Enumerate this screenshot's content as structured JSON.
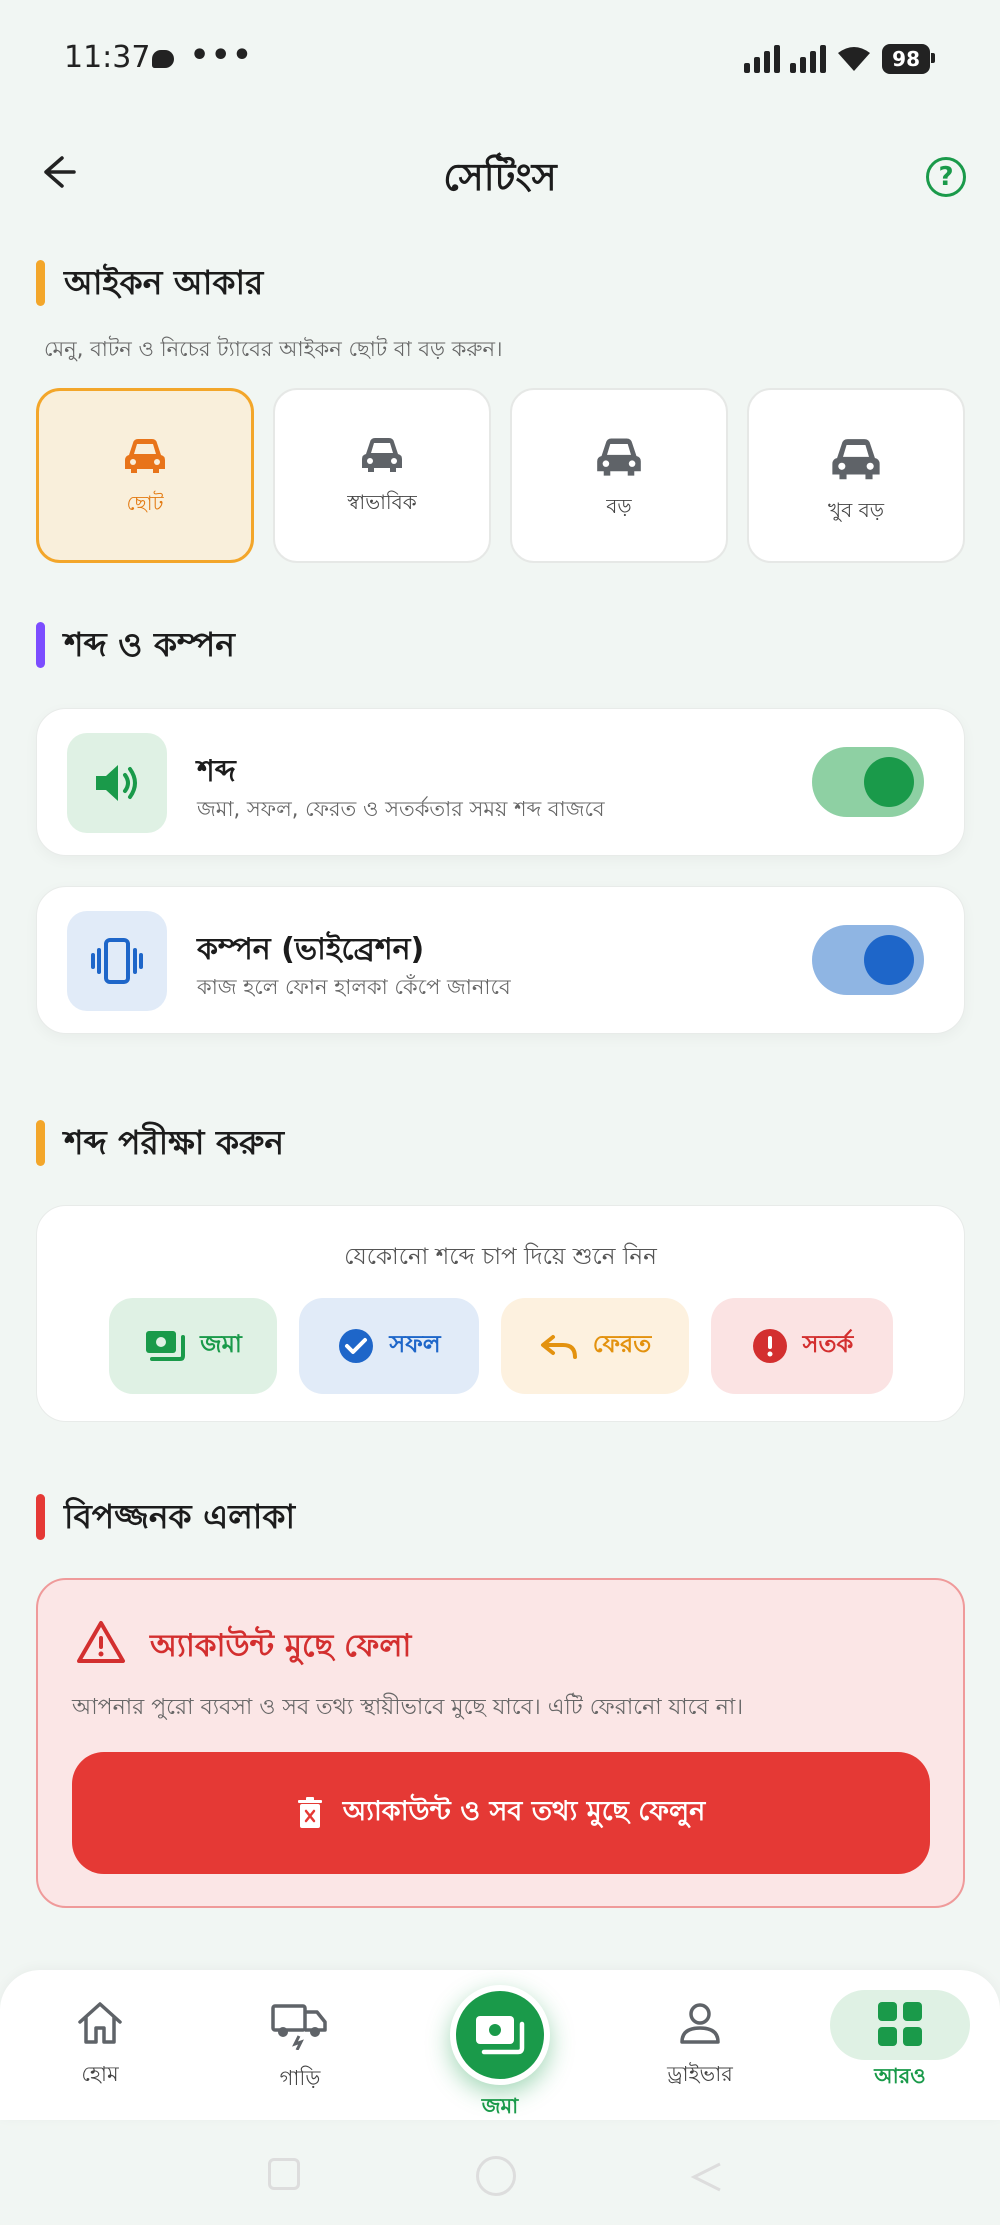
{
  "status": {
    "time": "11:37",
    "dots": "•••",
    "battery": "98"
  },
  "header": {
    "title": "সেটিংস",
    "help": "?"
  },
  "icon_size": {
    "title": "আইকন আকার",
    "desc": "মেনু, বাটন ও নিচের ট্যাবের আইকন ছোট বা বড় করুন।",
    "options": [
      {
        "label": "ছোট",
        "selected": true
      },
      {
        "label": "স্বাভাবিক",
        "selected": false
      },
      {
        "label": "বড়",
        "selected": false
      },
      {
        "label": "খুব বড়",
        "selected": false
      }
    ]
  },
  "sound_vibration": {
    "title": "শব্দ ও কম্পন",
    "sound": {
      "title": "শব্দ",
      "sub": "জমা, সফল, ফেরত ও সতর্কতার সময় শব্দ বাজবে",
      "on": true
    },
    "vibration": {
      "title": "কম্পন (ভাইব্রেশন)",
      "sub": "কাজ হলে ফোন হালকা কেঁপে জানাবে",
      "on": true
    }
  },
  "sound_test": {
    "title": "শব্দ পরীক্ষা করুন",
    "hint": "যেকোনো শব্দে চাপ দিয়ে শুনে নিন",
    "chips": [
      "জমা",
      "সফল",
      "ফেরত",
      "সতর্ক"
    ]
  },
  "danger": {
    "title": "বিপজ্জনক এলাকা",
    "card_title": "অ্যাকাউন্ট মুছে ফেলা",
    "desc": "আপনার পুরো ব্যবসা ও সব তথ্য স্থায়ীভাবে মুছে যাবে। এটি ফেরানো যাবে না।",
    "button": "অ্যাকাউন্ট ও সব তথ্য মুছে ফেলুন"
  },
  "nav": {
    "home": "হোম",
    "vehicle": "গাড়ি",
    "deposit": "জমা",
    "driver": "ড্রাইভার",
    "more": "আরও"
  },
  "colors": {
    "brand": "#1a9a4a",
    "accent_orange": "#f3a62a",
    "accent_purple": "#7c4dff",
    "danger": "#e53935",
    "vibration_blue": "#1e66c9"
  }
}
